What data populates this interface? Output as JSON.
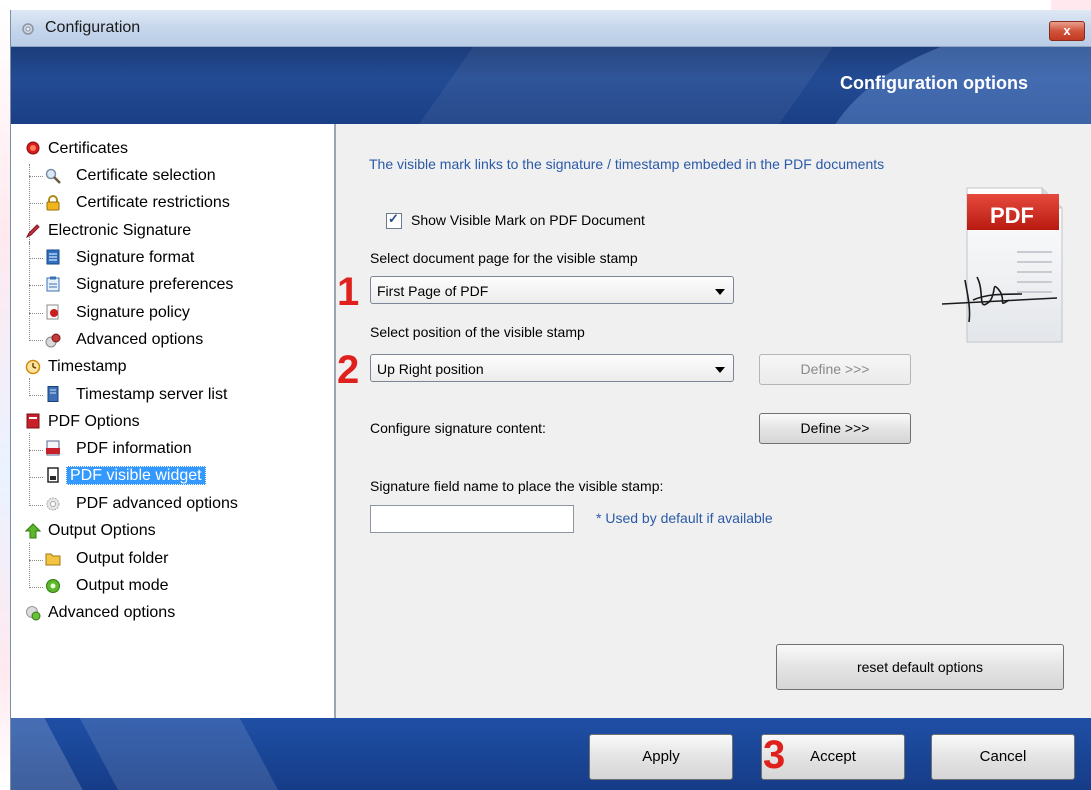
{
  "window": {
    "title": "Configuration",
    "close_label": "x",
    "banner_title": "Configuration options"
  },
  "tree": {
    "items": [
      {
        "label": "Certificates",
        "icon": "certificate-seal-icon"
      },
      {
        "label": "Certificate selection",
        "icon": "magnifier-icon"
      },
      {
        "label": "Certificate restrictions",
        "icon": "padlock-icon"
      },
      {
        "label": "Electronic Signature",
        "icon": "pen-icon"
      },
      {
        "label": "Signature format",
        "icon": "document-icon"
      },
      {
        "label": "Signature preferences",
        "icon": "clipboard-icon"
      },
      {
        "label": "Signature policy",
        "icon": "policy-seal-icon"
      },
      {
        "label": "Advanced options",
        "icon": "gears-icon"
      },
      {
        "label": "Timestamp",
        "icon": "clock-icon"
      },
      {
        "label": "Timestamp server list",
        "icon": "server-icon"
      },
      {
        "label": "PDF Options",
        "icon": "pdf-book-icon"
      },
      {
        "label": "PDF information",
        "icon": "pdf-file-icon"
      },
      {
        "label": "PDF visible widget",
        "icon": "page-icon"
      },
      {
        "label": "PDF advanced options",
        "icon": "gear-icon"
      },
      {
        "label": "Output Options",
        "icon": "up-arrow-icon"
      },
      {
        "label": "Output folder",
        "icon": "folder-icon"
      },
      {
        "label": "Output mode",
        "icon": "green-circle-icon"
      },
      {
        "label": "Advanced options",
        "icon": "gears-icon"
      }
    ],
    "selected": "PDF visible widget"
  },
  "panel": {
    "info_text": "The visible mark links to the signature / timestamp embeded in the PDF documents",
    "show_mark_label": "Show Visible Mark on PDF Document",
    "show_mark_checked": true,
    "page_select_label": "Select document page for the visible stamp",
    "page_select_value": "First Page of PDF",
    "position_select_label": "Select position of the visible stamp",
    "position_select_value": "Up Right position",
    "define_position_label": "Define >>>",
    "content_label": "Configure signature content:",
    "define_content_label": "Define >>>",
    "field_name_label": "Signature field name to place the visible stamp:",
    "field_name_value": "",
    "field_hint": "* Used by default if available",
    "reset_label": "reset default options",
    "pdf_badge": "PDF",
    "step_1": "1",
    "step_2": "2"
  },
  "footer": {
    "apply_label": "Apply",
    "accept_label": "Accept",
    "cancel_label": "Cancel",
    "step_3": "3"
  },
  "colors": {
    "banner": "#234b93",
    "selected": "#3399ff",
    "info_text": "#2b5aa8",
    "step_marker": "#e0201c"
  }
}
